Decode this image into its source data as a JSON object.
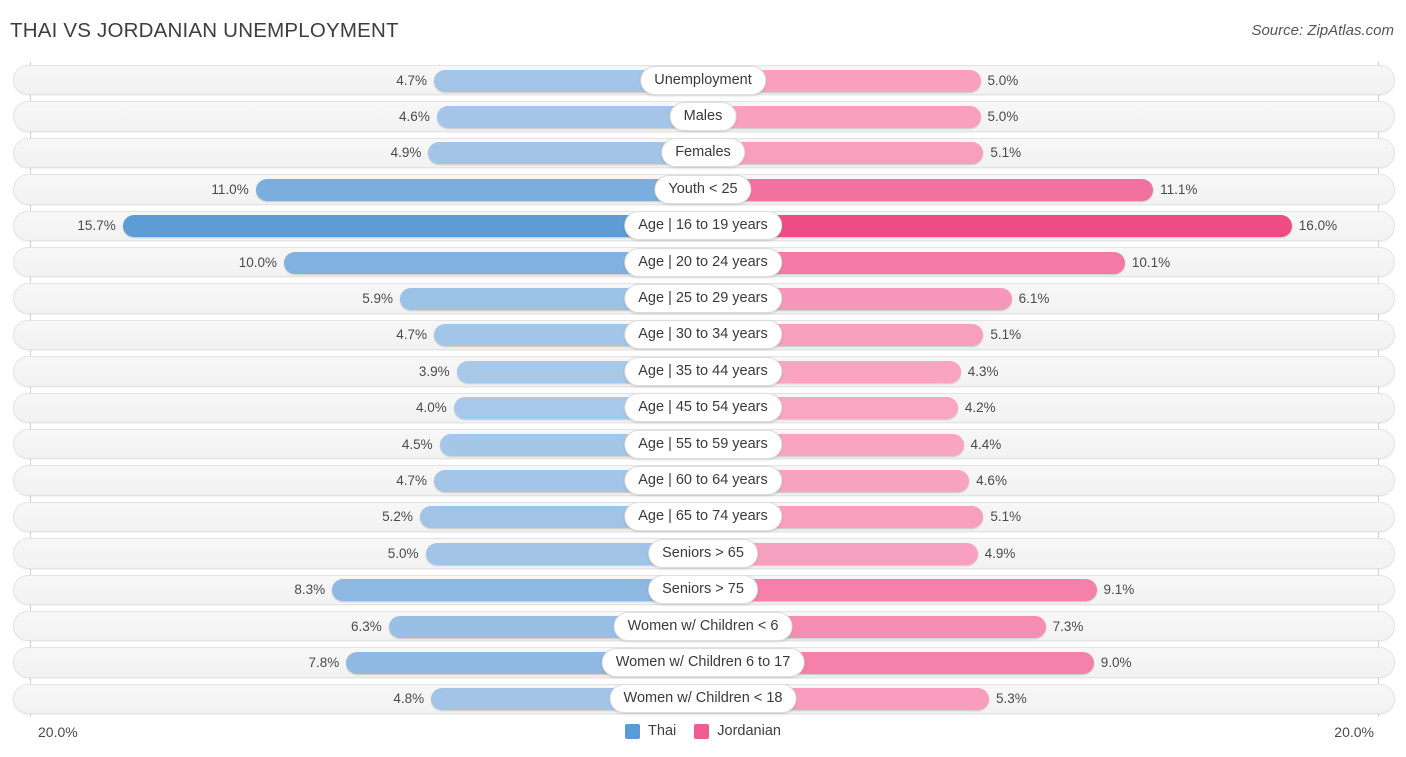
{
  "header": {
    "title": "THAI VS JORDANIAN UNEMPLOYMENT",
    "source": "Source: ZipAtlas.com"
  },
  "axis": {
    "left_label": "20.0%",
    "right_label": "20.0%",
    "max": 20.0
  },
  "legend": {
    "items": [
      {
        "name": "Thai",
        "color": "#5b9bd5"
      },
      {
        "name": "Jordanian",
        "color": "#ef5c90"
      }
    ]
  },
  "colors": {
    "thai_low": "#a8c8e8",
    "thai_high": "#5b9bd5",
    "jordanian_low": "#f9a8c4",
    "jordanian_high": "#ef4c86",
    "track": "#f4f4f4",
    "axis": "#d2d2d2"
  },
  "chart_data": {
    "type": "bar",
    "orientation": "diverging-horizontal",
    "title": "THAI VS JORDANIAN UNEMPLOYMENT",
    "xlabel": "",
    "ylabel": "",
    "xlim": [
      0,
      20.0
    ],
    "grid": false,
    "legend_position": "bottom-center",
    "unit": "%",
    "categories": [
      "Unemployment",
      "Males",
      "Females",
      "Youth < 25",
      "Age | 16 to 19 years",
      "Age | 20 to 24 years",
      "Age | 25 to 29 years",
      "Age | 30 to 34 years",
      "Age | 35 to 44 years",
      "Age | 45 to 54 years",
      "Age | 55 to 59 years",
      "Age | 60 to 64 years",
      "Age | 65 to 74 years",
      "Seniors > 65",
      "Seniors > 75",
      "Women w/ Children < 6",
      "Women w/ Children 6 to 17",
      "Women w/ Children < 18"
    ],
    "series": [
      {
        "name": "Thai",
        "values": [
          4.7,
          4.6,
          4.9,
          11.0,
          15.7,
          10.0,
          5.9,
          4.7,
          3.9,
          4.0,
          4.5,
          4.7,
          5.2,
          5.0,
          8.3,
          6.3,
          7.8,
          4.8
        ],
        "labels": [
          "4.7%",
          "4.6%",
          "4.9%",
          "11.0%",
          "15.7%",
          "10.0%",
          "5.9%",
          "4.7%",
          "3.9%",
          "4.0%",
          "4.5%",
          "4.7%",
          "5.2%",
          "5.0%",
          "8.3%",
          "6.3%",
          "7.8%",
          "4.8%"
        ]
      },
      {
        "name": "Jordanian",
        "values": [
          5.0,
          5.0,
          5.1,
          11.1,
          16.0,
          10.1,
          6.1,
          5.1,
          4.3,
          4.2,
          4.4,
          4.6,
          5.1,
          4.9,
          9.1,
          7.3,
          9.0,
          5.3
        ],
        "labels": [
          "5.0%",
          "5.0%",
          "5.1%",
          "11.1%",
          "16.0%",
          "10.1%",
          "6.1%",
          "5.1%",
          "4.3%",
          "4.2%",
          "4.4%",
          "4.6%",
          "5.1%",
          "4.9%",
          "9.1%",
          "7.3%",
          "9.0%",
          "5.3%"
        ]
      }
    ]
  }
}
